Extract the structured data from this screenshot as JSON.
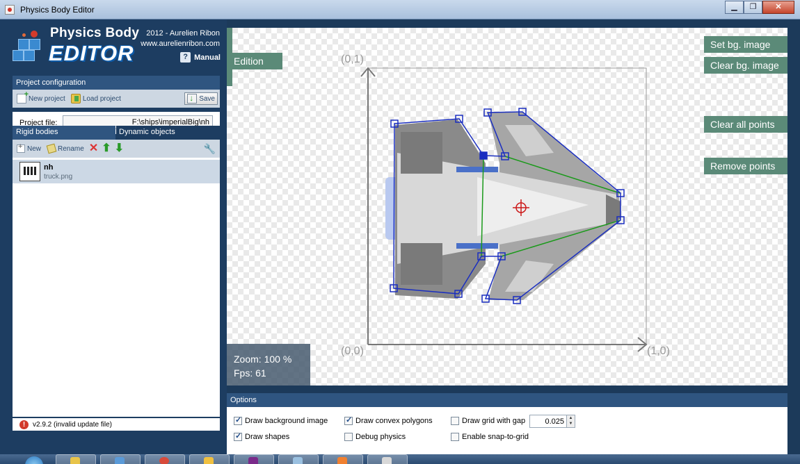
{
  "window": {
    "title": "Physics Body Editor",
    "buttons": [
      "▁",
      "❐",
      "✕"
    ]
  },
  "logo": {
    "line1": "Physics Body",
    "line2": "EDITOR"
  },
  "credits": {
    "line1": "2012 - Aurelien Ribon",
    "line2": "www.aurelienribon.com"
  },
  "manual": {
    "icon": "?",
    "label": "Manual"
  },
  "project": {
    "header": "Project configuration",
    "new_label": "New project",
    "load_label": "Load project",
    "save_label": "Save",
    "file_label": "Project file:",
    "file_value": "F:\\ships\\imperialBig\\nh"
  },
  "tabs": {
    "rigid": "Rigid bodies",
    "dynamic": "Dynamic objects"
  },
  "bodies_toolbar": {
    "new_label": "New",
    "rename_label": "Rename"
  },
  "bodies": [
    {
      "name": "nh",
      "file": "truck.png"
    }
  ],
  "status": {
    "text": "v2.9.2 (invalid update file)"
  },
  "canvas": {
    "mode_label": "Edition",
    "buttons": {
      "set_bg": "Set bg. image",
      "clear_bg": "Clear bg. image",
      "clear_points": "Clear all points",
      "remove_points": "Remove points"
    },
    "coords": {
      "top_left": "(0,1)",
      "bottom_left": "(0,0)",
      "bottom_right": "(1,0)"
    },
    "zoom": "Zoom: 100 %",
    "fps": "Fps: 61"
  },
  "options": {
    "header": "Options",
    "draw_bg": {
      "label": "Draw background image",
      "checked": true
    },
    "draw_shapes": {
      "label": "Draw shapes",
      "checked": true
    },
    "draw_convex": {
      "label": "Draw convex polygons",
      "checked": true
    },
    "debug_physics": {
      "label": "Debug physics",
      "checked": false
    },
    "draw_grid": {
      "label": "Draw grid with gap",
      "checked": false
    },
    "snap_grid": {
      "label": "Enable snap-to-grid",
      "checked": false
    },
    "grid_gap": "0.025"
  },
  "colors": {
    "accent": "#5b8a78",
    "panel": "#1d3d61",
    "header": "#2f5580",
    "shape": "#1a2ec0",
    "convex": "#1a9a1a",
    "origin": "#cc1a1a"
  },
  "taskbar": {
    "items": [
      "explorer-icon",
      "media-icon",
      "chrome-icon",
      "folder-icon",
      "app-icon",
      "window-icon",
      "java-icon",
      "editor-icon"
    ]
  }
}
